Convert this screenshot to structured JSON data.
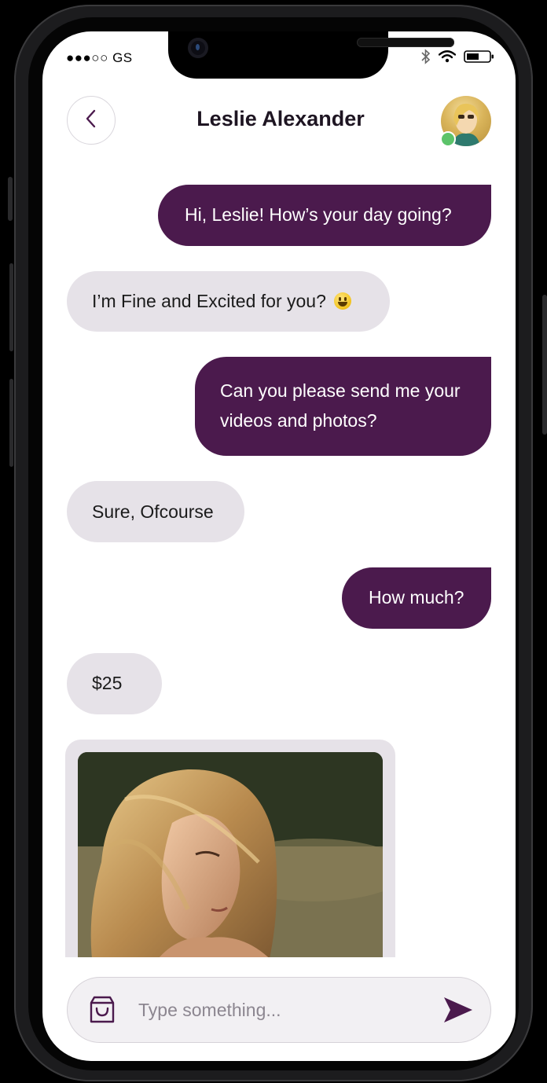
{
  "status_bar": {
    "carrier": "●●●○○ GS"
  },
  "header": {
    "title": "Leslie Alexander",
    "avatar_online": true
  },
  "messages": [
    {
      "side": "out",
      "text": "Hi, Leslie! How’s your day going?"
    },
    {
      "side": "in",
      "text": "I’m Fine and Excited for you?",
      "emoji": "grinning-face-icon"
    },
    {
      "side": "out",
      "text": "Can you please send me your videos and photos?"
    },
    {
      "side": "in",
      "text": "Sure, Ofcourse"
    },
    {
      "side": "out",
      "text": "How much?"
    },
    {
      "side": "in",
      "text": "$25"
    }
  ],
  "composer": {
    "placeholder": "Type something...",
    "value": ""
  },
  "colors": {
    "accent": "#4b1a4d",
    "incoming_bubble": "#e6e2e8",
    "online": "#5cc36a"
  }
}
